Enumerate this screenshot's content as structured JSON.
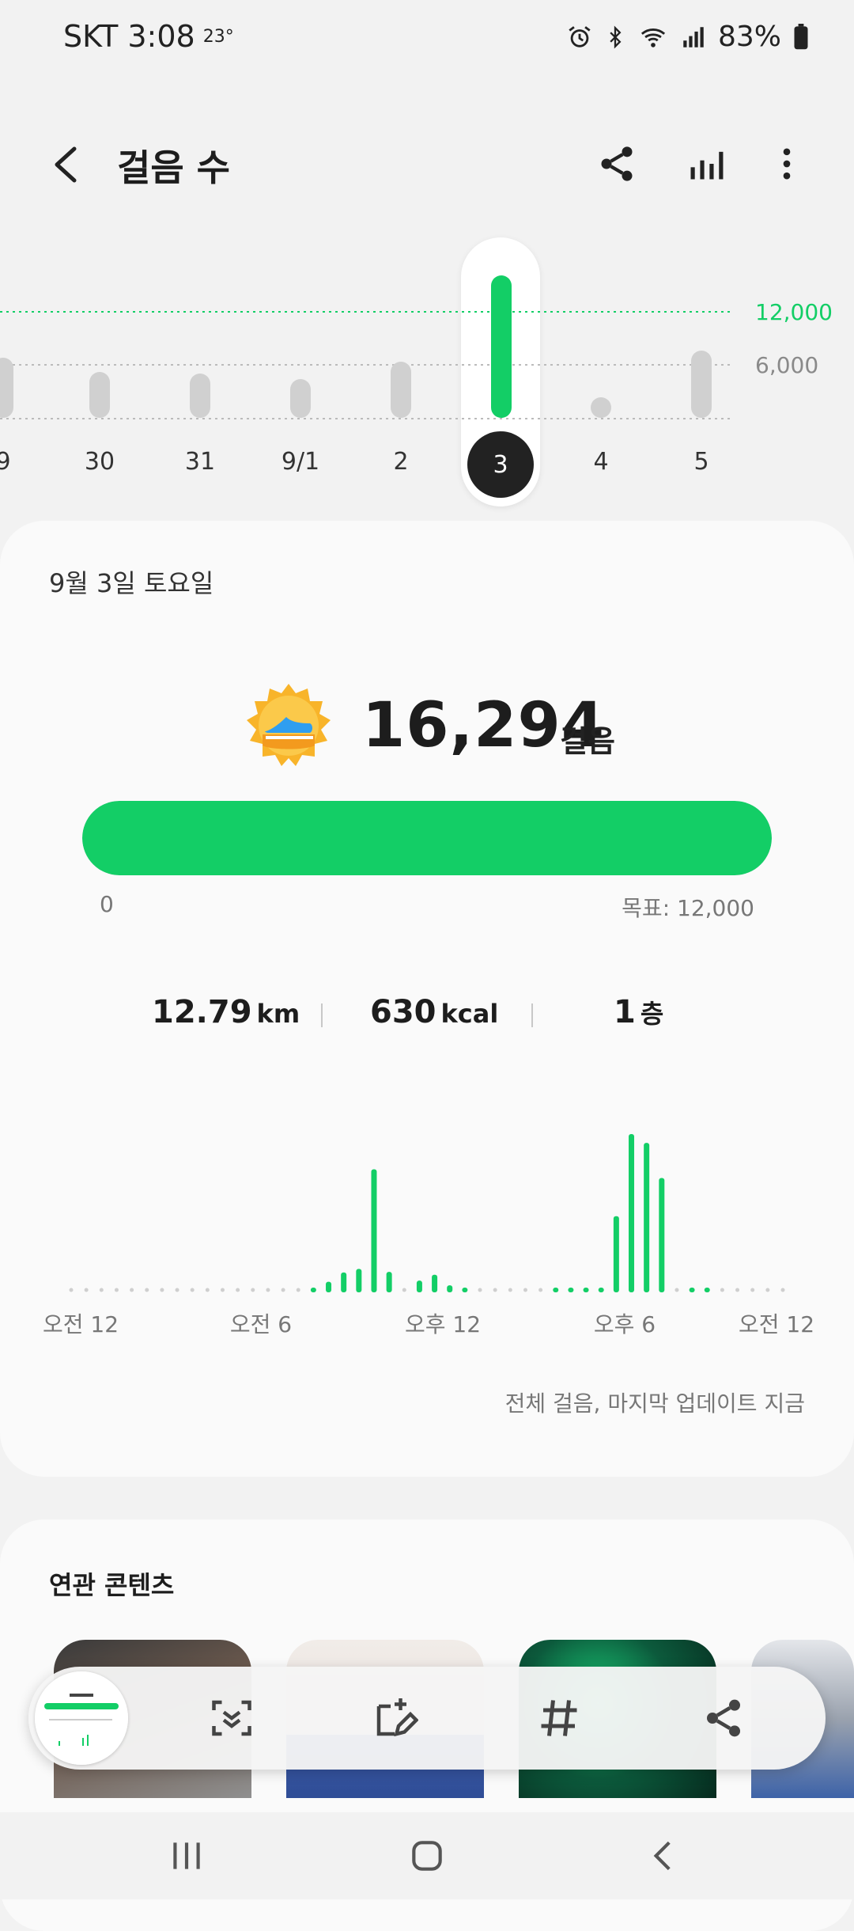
{
  "status_bar": {
    "carrier_time": "SKT 3:08",
    "temperature": "23°",
    "battery": "83%",
    "icons": [
      "alarm-icon",
      "bluetooth-icon",
      "wifi-icon",
      "signal-icon",
      "battery-icon"
    ]
  },
  "header": {
    "title": "걸음 수",
    "icons": [
      "back-icon",
      "share-icon",
      "bar-chart-icon",
      "more-icon"
    ]
  },
  "week_chart": {
    "goal_label": "12,000",
    "mid_label": "6,000",
    "days": [
      "9",
      "30",
      "31",
      "9/1",
      "2",
      "3",
      "4",
      "5"
    ],
    "selected_day": "3",
    "step_values": [
      6800,
      5200,
      5000,
      4400,
      6400,
      16294,
      900,
      7600
    ],
    "goal": 12000,
    "colors": {
      "accent": "#13ce66",
      "bar": "#d0d0d0"
    }
  },
  "summary": {
    "date": "9월 3일 토요일",
    "steps": "16,294",
    "steps_unit": "걸음",
    "progress": 1.0,
    "progress_min": "0",
    "goal_text": "목표: 12,000",
    "distance": "12.79",
    "distance_unit": "km",
    "calories": "630",
    "calories_unit": "kcal",
    "floors": "1",
    "floors_unit": "층"
  },
  "chart_data": {
    "type": "bar",
    "x_labels": [
      "오전 12",
      "오전 6",
      "오후 12",
      "오후 6",
      "오전 12"
    ],
    "values": [
      0,
      0,
      0,
      0,
      0,
      0,
      0,
      0,
      0,
      0,
      0,
      0,
      0,
      0,
      0,
      0,
      80,
      180,
      340,
      400,
      2100,
      350,
      0,
      200,
      300,
      120,
      80,
      0,
      0,
      0,
      0,
      0,
      80,
      80,
      80,
      80,
      1300,
      2700,
      2550,
      1950,
      0,
      80,
      80,
      0,
      0,
      0,
      0,
      0
    ],
    "interval": "30 min",
    "color": "#13ce66",
    "footnote": "전체 걸음, 마지막 업데이트 지금"
  },
  "related": {
    "title": "연관 콘텐츠"
  },
  "toolbar": {
    "icons": [
      "scroll-capture-icon",
      "edit-icon",
      "tag-icon",
      "share-icon"
    ]
  },
  "navbar": {
    "icons": [
      "recents-icon",
      "home-icon",
      "back-nav-icon"
    ]
  }
}
